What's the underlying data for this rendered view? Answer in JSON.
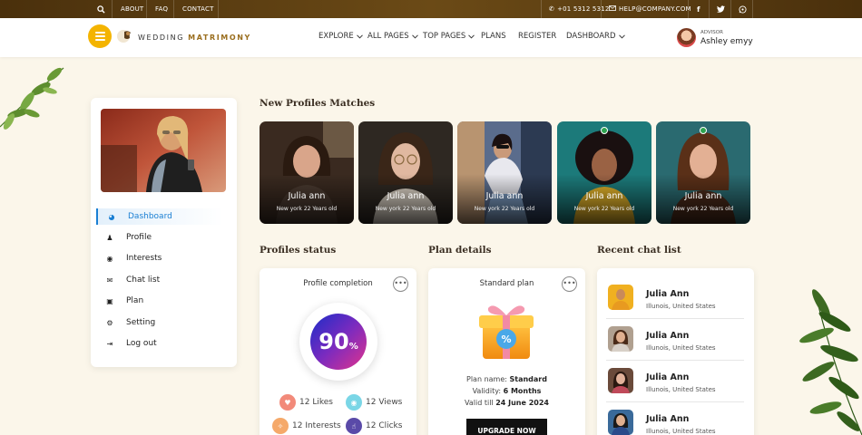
{
  "topbar": {
    "links": [
      "ABOUT",
      "FAQ",
      "CONTACT"
    ],
    "phone": "+01 5312 5312",
    "email": "HELP@COMPANY.COM"
  },
  "header": {
    "logo_text_light": "WEDDING ",
    "logo_text_bold": "MATRIMONY",
    "nav": [
      {
        "label": "EXPLORE"
      },
      {
        "label": "ALL PAGES"
      },
      {
        "label": "TOP PAGES"
      },
      {
        "label": "PLANS"
      },
      {
        "label": "REGISTER"
      },
      {
        "label": "DASHBOARD"
      }
    ],
    "advisor_role": "ADVISOR",
    "advisor_name": "Ashley emyy"
  },
  "sidebar": {
    "items": [
      {
        "label": "Dashboard",
        "icon": "dashboard-icon",
        "glyph": "◕"
      },
      {
        "label": "Profile",
        "icon": "person-icon",
        "glyph": "♟"
      },
      {
        "label": "Interests",
        "icon": "eye-icon",
        "glyph": "◉"
      },
      {
        "label": "Chat list",
        "icon": "chat-icon",
        "glyph": "✉"
      },
      {
        "label": "Plan",
        "icon": "plan-icon",
        "glyph": "▣"
      },
      {
        "label": "Setting",
        "icon": "gear-icon",
        "glyph": "⚙"
      },
      {
        "label": "Log out",
        "icon": "logout-icon",
        "glyph": "⇥"
      }
    ]
  },
  "matches": {
    "title": "New Profiles Matches",
    "profiles": [
      {
        "name": "Julia ann",
        "info": "New york 22 Years old",
        "online": false
      },
      {
        "name": "Julia ann",
        "info": "New york 22 Years old",
        "online": false
      },
      {
        "name": "Julia ann",
        "info": "New york 22 Years old",
        "online": false
      },
      {
        "name": "Julia ann",
        "info": "New york 22 Years old",
        "online": true
      },
      {
        "name": "Julia ann",
        "info": "New york 22 Years old",
        "online": true
      }
    ]
  },
  "profiles_status": {
    "title": "Profiles status",
    "card_title": "Profile completion",
    "percent_number": "90",
    "percent_sign": "%",
    "stats": [
      {
        "value": "12",
        "label": "Likes"
      },
      {
        "value": "12",
        "label": "Views"
      },
      {
        "value": "12",
        "label": "Interests"
      },
      {
        "value": "12",
        "label": "Clicks"
      }
    ]
  },
  "plan": {
    "title": "Plan details",
    "card_title": "Standard plan",
    "name_label": "Plan name: ",
    "name_value": "Standard",
    "validity_label": "Validity: ",
    "validity_value": "6 Months",
    "valid_till_label": "Valid till ",
    "valid_till_value": "24 June 2024",
    "upgrade_label": "UPGRADE NOW",
    "badge": "%"
  },
  "chat": {
    "title": "Recent chat list",
    "items": [
      {
        "name": "Julia Ann",
        "location": "Illunois, United States"
      },
      {
        "name": "Julia Ann",
        "location": "Illunois, United States"
      },
      {
        "name": "Julia Ann",
        "location": "Illunois, United States"
      },
      {
        "name": "Julia Ann",
        "location": "Illunois, United States"
      }
    ]
  }
}
